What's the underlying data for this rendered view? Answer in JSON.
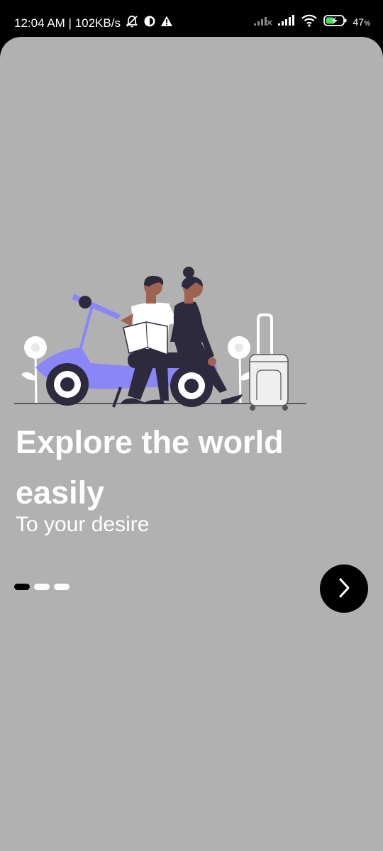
{
  "status_bar": {
    "time_speed": "12:04 AM | 102KB/s",
    "battery_percent": "47",
    "battery_unit": "%"
  },
  "onboarding": {
    "headline": "Explore the world easily",
    "subtitle": "To your desire",
    "page_count": 3,
    "active_page": 0
  },
  "colors": {
    "screen_background": "#b1b1b1",
    "scooter": "#8a86f7",
    "outfit_dark": "#2d2a3d",
    "skin": "#9e6451"
  },
  "icons": {
    "next_button": "chevron-right-icon"
  }
}
